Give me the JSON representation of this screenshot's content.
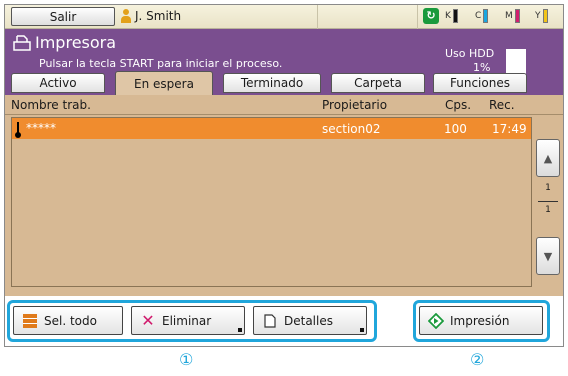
{
  "topbar": {
    "logout_label": "Salir",
    "user_name": "J. Smith",
    "inks": [
      {
        "label": "K",
        "color": "#111111",
        "level": 0.9
      },
      {
        "label": "C",
        "color": "#1aa6e0",
        "level": 0.9
      },
      {
        "label": "M",
        "color": "#d21f6e",
        "level": 0.9
      },
      {
        "label": "Y",
        "color": "#f2c418",
        "level": 0.9
      }
    ]
  },
  "header": {
    "title": "Impresora",
    "subtitle": "Pulsar la tecla START para iniciar el proceso.",
    "hdd_label": "Uso HDD",
    "hdd_value": "1%"
  },
  "tabs": [
    {
      "label": "Activo",
      "active": false
    },
    {
      "label": "En espera",
      "active": true
    },
    {
      "label": "Terminado",
      "active": false
    },
    {
      "label": "Carpeta",
      "active": false
    },
    {
      "label": "Funciones",
      "active": false
    }
  ],
  "list": {
    "columns": {
      "name": "Nombre trab.",
      "owner": "Propietario",
      "copies": "Cps.",
      "received": "Rec."
    },
    "rows": [
      {
        "name": "*****",
        "owner": "section02",
        "copies": "100",
        "received": "17:49",
        "selected": true
      }
    ],
    "page_current": "1",
    "page_total": "1"
  },
  "toolbar": {
    "select_all_label": "Sel. todo",
    "delete_label": "Eliminar",
    "details_label": "Detalles",
    "print_label": "Impresión"
  },
  "markers": {
    "group1": "①",
    "group2": "②"
  },
  "colors": {
    "header_bg": "#7a4e8f",
    "list_bg": "#d7b994",
    "selected_row": "#f08c2e",
    "highlight": "#20a6db"
  }
}
